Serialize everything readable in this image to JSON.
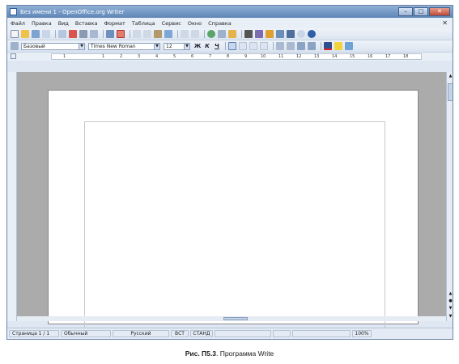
{
  "window": {
    "title": "Без имени 1 - OpenOffice.org Writer",
    "minimize": "–",
    "maximize": "□",
    "close": "✕"
  },
  "menu": {
    "items": [
      "Файл",
      "Правка",
      "Вид",
      "Вставка",
      "Формат",
      "Таблица",
      "Сервис",
      "Окно",
      "Справка"
    ],
    "close_doc": "✕"
  },
  "formatting": {
    "style": "Базовый",
    "font": "Times New Roman",
    "size": "12",
    "bold": "Ж",
    "italic": "К",
    "underline": "Ч"
  },
  "ruler": {
    "labels": [
      "1",
      "1",
      "2",
      "3",
      "4",
      "5",
      "6",
      "7",
      "8",
      "9",
      "10",
      "11",
      "12",
      "13",
      "14",
      "15",
      "16",
      "17",
      "18"
    ]
  },
  "status": {
    "page": "Страница 1 / 1",
    "style": "Обычный",
    "language": "Русский",
    "insert_mode": "ВСТ",
    "selection_mode": "СТАНД",
    "zoom": "100%"
  },
  "caption": {
    "label": "Рис. П5.3",
    "text": ". Программа Write"
  },
  "colors": {
    "titlebar": "#5f86b8",
    "workspace": "#ababab",
    "close": "#c24a35"
  }
}
